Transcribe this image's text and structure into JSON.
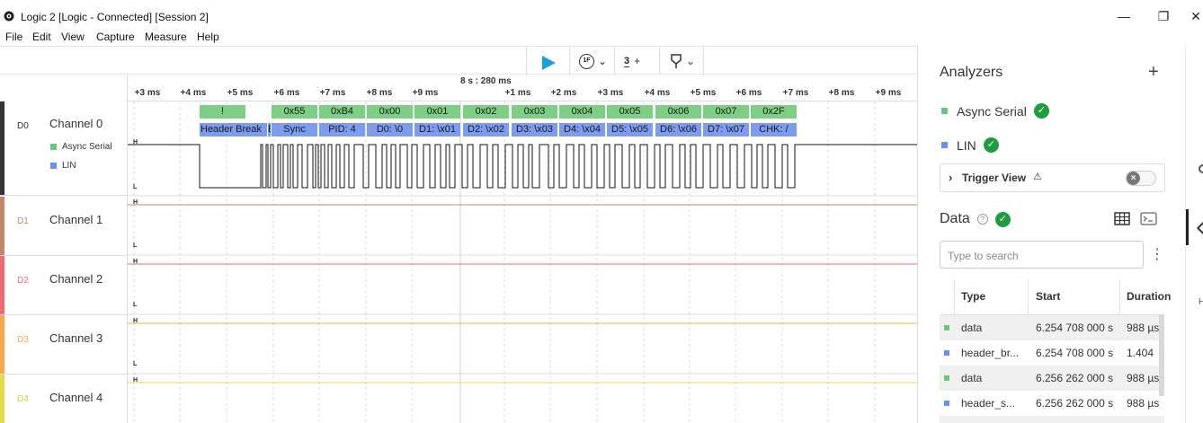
{
  "window": {
    "title": "Logic 2 [Logic - Connected] [Session 2]",
    "minimize_glyph": "—",
    "restore_glyph": "❐",
    "close_glyph": "✕"
  },
  "menu": [
    "File",
    "Edit",
    "View",
    "Capture",
    "Measure",
    "Help"
  ],
  "toolbar": {
    "play_icon": "play-icon",
    "trigger_icon": "trigger-icon",
    "trigger_glyph": "1F",
    "measure_icon": "measure-icon",
    "measure_glyph": "3",
    "measure_plus": "+",
    "marker_icon": "marker-icon",
    "chevron_glyph": "⌄",
    "play_color": "#1f9fd8"
  },
  "timeline": {
    "reference": "8 s : 280 ms",
    "ticks": [
      "+3 ms",
      "+4 ms",
      "+5 ms",
      "+6 ms",
      "+7 ms",
      "+8 ms",
      "+9 ms",
      "+1 ms",
      "+2 ms",
      "+3 ms",
      "+4 ms",
      "+5 ms",
      "+6 ms",
      "+7 ms",
      "+8 ms",
      "+9 ms"
    ]
  },
  "channels": [
    {
      "id": "D0",
      "name": "Channel 0",
      "color": "#333333",
      "analyzers": [
        {
          "name": "Async Serial",
          "color": "#6cc77a"
        },
        {
          "name": "LIN",
          "color": "#6b8ef0"
        }
      ]
    },
    {
      "id": "D1",
      "name": "Channel 1",
      "color": "#c4866a"
    },
    {
      "id": "D2",
      "name": "Channel 2",
      "color": "#f06b7a"
    },
    {
      "id": "D3",
      "name": "Channel 3",
      "color": "#f5a849"
    },
    {
      "id": "D4",
      "name": "Channel 4",
      "color": "#e8d94a"
    }
  ],
  "levels": {
    "high": "H",
    "low": "L"
  },
  "serial_frames": [
    "!",
    "0x55",
    "0xB4",
    "0x00",
    "0x01",
    "0x02",
    "0x03",
    "0x04",
    "0x05",
    "0x06",
    "0x07",
    "0x2F"
  ],
  "lin_frames": [
    "Header Break",
    "E",
    "Sync",
    "PID: 4",
    "D0: \\0",
    "D1: \\x01",
    "D2: \\x02",
    "D3: \\x03",
    "D4: \\x04",
    "D5: \\x05",
    "D6: \\x06",
    "D7: \\x07",
    "CHK: /"
  ],
  "colors": {
    "serial": "#7ccf84",
    "lin": "#7d9cf0",
    "check_green": "#1f9d3d"
  },
  "analyzers_panel": {
    "title": "Analyzers",
    "add_label": "+",
    "items": [
      {
        "name": "Async Serial",
        "color": "#6cc77a"
      },
      {
        "name": "LIN",
        "color": "#6b8ef0"
      }
    ],
    "trigger_view": {
      "chevron": "›",
      "label": "Trigger View",
      "warn": "⚠"
    },
    "check_glyph": "✓"
  },
  "data_panel": {
    "title": "Data",
    "help_glyph": "?",
    "search_placeholder": "Type to search",
    "kebab_glyph": "⋮",
    "columns": [
      "Type",
      "Start",
      "Duration"
    ],
    "rows": [
      {
        "marker": "#6cc77a",
        "type": "data",
        "start": "6.254 708 000 s",
        "duration": "988 µs"
      },
      {
        "marker": "#6b8ef0",
        "type": "header_br...",
        "start": "6.254 708 000 s",
        "duration": "1.404"
      },
      {
        "marker": "#6cc77a",
        "type": "data",
        "start": "6.256 262 000 s",
        "duration": "988 µs"
      },
      {
        "marker": "#6b8ef0",
        "type": "header_s...",
        "start": "6.256 262 000 s",
        "duration": "988 µs"
      }
    ]
  }
}
